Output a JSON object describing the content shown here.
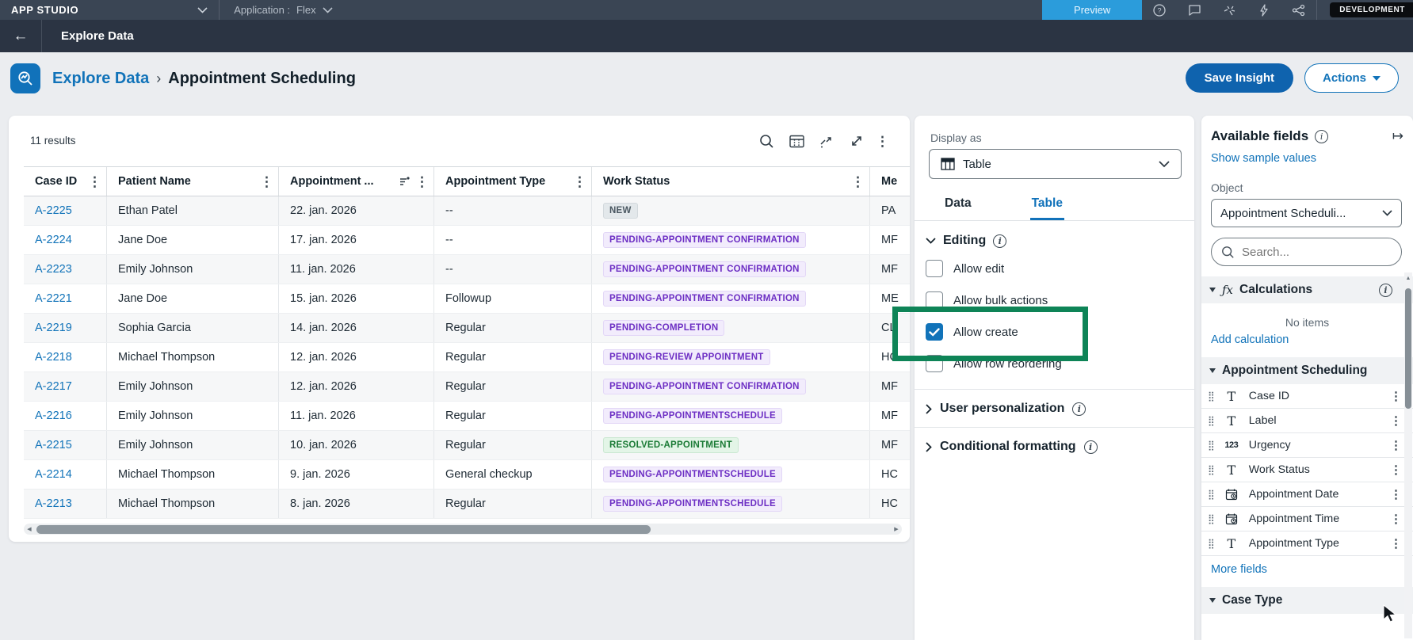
{
  "topbar": {
    "app_name": "APP STUDIO",
    "application_label": "Application :",
    "application_value": "Flex",
    "preview_label": "Preview",
    "env_badge": "DEVELOPMENT"
  },
  "nav": {
    "title": "Explore Data"
  },
  "header": {
    "breadcrumb_parent": "Explore Data",
    "breadcrumb_separator": "›",
    "breadcrumb_current": "Appointment Scheduling",
    "save_button": "Save Insight",
    "actions_button": "Actions"
  },
  "table_card": {
    "results_count": "11 results",
    "columns": [
      "Case ID",
      "Patient Name",
      "Appointment ...",
      "Appointment Type",
      "Work Status"
    ],
    "partial_column": "Me",
    "rows": [
      {
        "id": "A-2225",
        "patient": "Ethan Patel",
        "date": "22. jan. 2026",
        "type": "--",
        "status": "NEW",
        "status_kind": "new",
        "partial": "PA"
      },
      {
        "id": "A-2224",
        "patient": "Jane Doe",
        "date": "17. jan. 2026",
        "type": "--",
        "status": "PENDING-APPOINTMENT CONFIRMATION",
        "status_kind": "pending",
        "partial": "MF"
      },
      {
        "id": "A-2223",
        "patient": "Emily Johnson",
        "date": "11. jan. 2026",
        "type": "--",
        "status": "PENDING-APPOINTMENT CONFIRMATION",
        "status_kind": "pending",
        "partial": "MF"
      },
      {
        "id": "A-2221",
        "patient": "Jane Doe",
        "date": "15. jan. 2026",
        "type": "Followup",
        "status": "PENDING-APPOINTMENT CONFIRMATION",
        "status_kind": "pending",
        "partial": "ME"
      },
      {
        "id": "A-2219",
        "patient": "Sophia Garcia",
        "date": "14. jan. 2026",
        "type": "Regular",
        "status": "PENDING-COMPLETION",
        "status_kind": "pending",
        "partial": "CL"
      },
      {
        "id": "A-2218",
        "patient": "Michael Thompson",
        "date": "12. jan. 2026",
        "type": "Regular",
        "status": "PENDING-REVIEW APPOINTMENT",
        "status_kind": "pending",
        "partial": "HC"
      },
      {
        "id": "A-2217",
        "patient": "Emily Johnson",
        "date": "12. jan. 2026",
        "type": "Regular",
        "status": "PENDING-APPOINTMENT CONFIRMATION",
        "status_kind": "pending",
        "partial": "MF"
      },
      {
        "id": "A-2216",
        "patient": "Emily Johnson",
        "date": "11. jan. 2026",
        "type": "Regular",
        "status": "PENDING-APPOINTMENTSCHEDULE",
        "status_kind": "pending",
        "partial": "MF"
      },
      {
        "id": "A-2215",
        "patient": "Emily Johnson",
        "date": "10. jan. 2026",
        "type": "Regular",
        "status": "RESOLVED-APPOINTMENT",
        "status_kind": "resolved",
        "partial": "MF"
      },
      {
        "id": "A-2214",
        "patient": "Michael Thompson",
        "date": "9. jan. 2026",
        "type": "General checkup",
        "status": "PENDING-APPOINTMENTSCHEDULE",
        "status_kind": "pending",
        "partial": "HC"
      },
      {
        "id": "A-2213",
        "patient": "Michael Thompson",
        "date": "8. jan. 2026",
        "type": "Regular",
        "status": "PENDING-APPOINTMENTSCHEDULE",
        "status_kind": "pending",
        "partial": "HC"
      }
    ]
  },
  "display_panel": {
    "display_as_label": "Display as",
    "display_as_value": "Table",
    "tabs": {
      "data": "Data",
      "table": "Table"
    },
    "editing_title": "Editing",
    "checkboxes": [
      {
        "label": "Allow edit",
        "state": "unchecked"
      },
      {
        "label": "Allow bulk actions",
        "state": "unchecked"
      },
      {
        "label": "Allow create",
        "state": "checked"
      },
      {
        "label": "Allow row reordering",
        "state": "unchecked"
      }
    ],
    "collapsed_sections": [
      {
        "label": "User personalization"
      },
      {
        "label": "Conditional formatting"
      }
    ]
  },
  "fields_panel": {
    "title": "Available fields",
    "show_sample_link": "Show sample values",
    "object_label": "Object",
    "object_value": "Appointment Scheduli...",
    "search_placeholder": "Search...",
    "calculations_title": "Calculations",
    "calculations_empty": "No items",
    "add_calculation_link": "Add calculation",
    "group_title": "Appointment Scheduling",
    "fields": [
      {
        "name": "Case ID",
        "type": "text"
      },
      {
        "name": "Label",
        "type": "text"
      },
      {
        "name": "Urgency",
        "type": "number"
      },
      {
        "name": "Work Status",
        "type": "text"
      },
      {
        "name": "Appointment Date",
        "type": "date"
      },
      {
        "name": "Appointment Time",
        "type": "date"
      },
      {
        "name": "Appointment Type",
        "type": "text"
      }
    ],
    "number_glyph": "123",
    "text_glyph": "T",
    "more_fields_link": "More fields",
    "case_type_title": "Case Type"
  },
  "colors": {
    "accent_blue": "#1173B9",
    "primary_button": "#0F63AE",
    "preview_button": "#2B9CDB",
    "annotation_green": "#0E8457",
    "badge_pending": "#6D2FC4",
    "badge_resolved": "#1A7A35"
  }
}
